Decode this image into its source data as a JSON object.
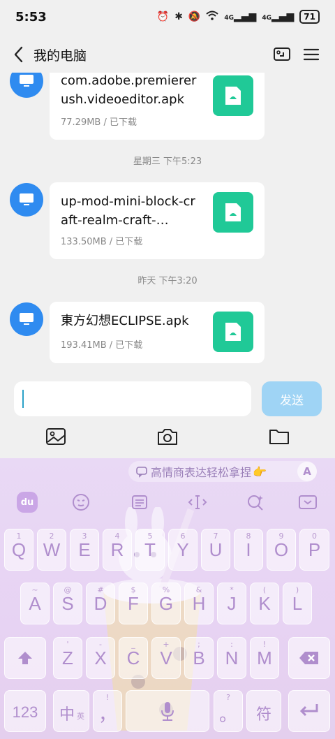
{
  "status_bar": {
    "time": "5:53",
    "battery": "71",
    "net1": "4G",
    "net2": "4G"
  },
  "header": {
    "title": "我的电脑"
  },
  "messages": [
    {
      "name": "com.adobe.premiererush.videoeditor.apk",
      "meta": "77.29MB / 已下载"
    },
    {
      "separator": "星期三 下午5:23",
      "name": "up-mod-mini-block-craft-realm-craft-…",
      "meta": "133.50MB / 已下载"
    },
    {
      "separator": "昨天 下午3:20",
      "name": "東方幻想ECLIPSE.apk",
      "meta": "193.41MB / 已下载"
    }
  ],
  "input": {
    "value": "",
    "send_label": "发送"
  },
  "keyboard": {
    "suggestion": "高情商表达轻松拿捏",
    "suggestion_emoji": "👉",
    "suggestion_btn": "A",
    "toolbar_logo": "du",
    "row1": [
      {
        "main": "Q",
        "sub": "1"
      },
      {
        "main": "W",
        "sub": "2"
      },
      {
        "main": "E",
        "sub": "3"
      },
      {
        "main": "R",
        "sub": "4"
      },
      {
        "main": "T",
        "sub": "5"
      },
      {
        "main": "Y",
        "sub": "6"
      },
      {
        "main": "U",
        "sub": "7"
      },
      {
        "main": "I",
        "sub": "8"
      },
      {
        "main": "O",
        "sub": "9"
      },
      {
        "main": "P",
        "sub": "0"
      }
    ],
    "row2": [
      {
        "main": "A",
        "sub": "~"
      },
      {
        "main": "S",
        "sub": "@"
      },
      {
        "main": "D",
        "sub": "#"
      },
      {
        "main": "F",
        "sub": "$"
      },
      {
        "main": "G",
        "sub": "%"
      },
      {
        "main": "H",
        "sub": "&"
      },
      {
        "main": "J",
        "sub": "*"
      },
      {
        "main": "K",
        "sub": "("
      },
      {
        "main": "L",
        "sub": ")"
      }
    ],
    "row3": [
      {
        "main": "Z",
        "sub": "'"
      },
      {
        "main": "X",
        "sub": "-"
      },
      {
        "main": "C",
        "sub": "_"
      },
      {
        "main": "V",
        "sub": "+"
      },
      {
        "main": "B",
        "sub": ";"
      },
      {
        "main": "N",
        "sub": ":"
      },
      {
        "main": "M",
        "sub": "!"
      }
    ],
    "num_key": "123",
    "lang_key": "中",
    "lang_key_sub": "英",
    "comma_key": "，",
    "comma_sub": "!",
    "period_key": "。",
    "period_sub": "?",
    "symbol_key": "符"
  }
}
